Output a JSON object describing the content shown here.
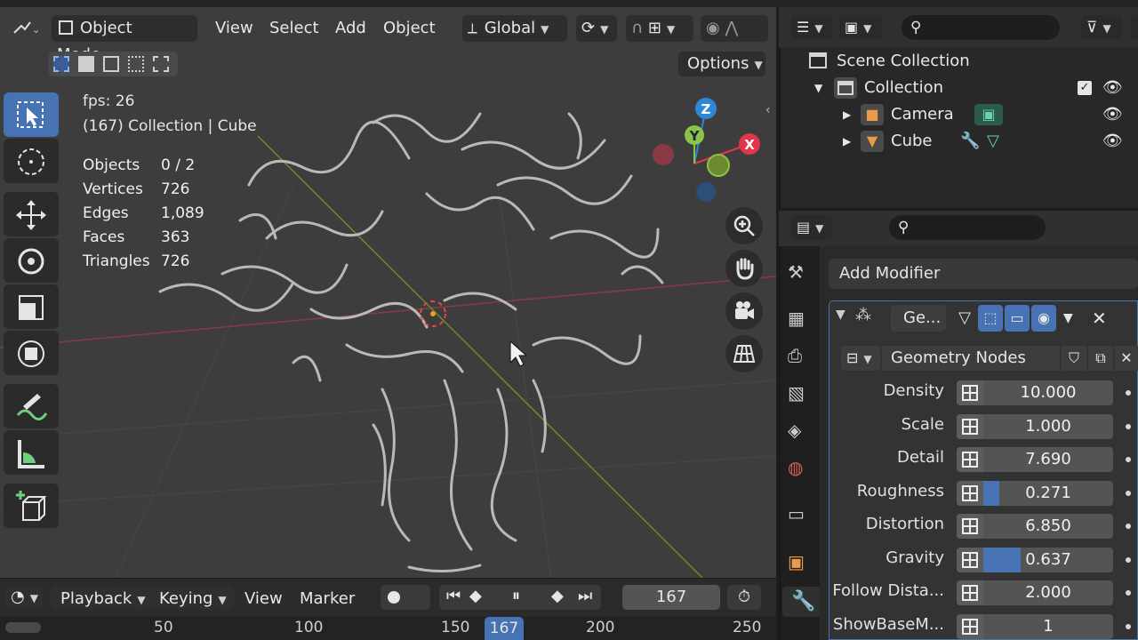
{
  "viewport_header": {
    "mode": "Object Mode",
    "menus": [
      "View",
      "Select",
      "Add",
      "Object"
    ],
    "transform_orientation": "Global",
    "options": "Options"
  },
  "overlay": {
    "fps": "fps: 26",
    "context": "(167) Collection | Cube",
    "stats": [
      {
        "label": "Objects",
        "value": "0 / 2"
      },
      {
        "label": "Vertices",
        "value": "726"
      },
      {
        "label": "Edges",
        "value": "1,089"
      },
      {
        "label": "Faces",
        "value": "363"
      },
      {
        "label": "Triangles",
        "value": "726"
      }
    ]
  },
  "gizmo": {
    "x": "X",
    "y": "Y",
    "z": "Z"
  },
  "timeline": {
    "menus": [
      "Playback",
      "Keying",
      "View",
      "Marker"
    ],
    "current_frame": "167",
    "ruler": [
      "50",
      "100",
      "150",
      "167",
      "200",
      "250"
    ]
  },
  "outliner": {
    "root": "Scene Collection",
    "collection": "Collection",
    "items": [
      {
        "label": "Camera"
      },
      {
        "label": "Cube"
      }
    ]
  },
  "properties": {
    "add_modifier": "Add Modifier",
    "modifier_name": "Ge...",
    "node_group": "Geometry Nodes",
    "inputs": [
      {
        "label": "Density",
        "value": "10.000",
        "fill": 0
      },
      {
        "label": "Scale",
        "value": "1.000",
        "fill": 0
      },
      {
        "label": "Detail",
        "value": "7.690",
        "fill": 0
      },
      {
        "label": "Roughness",
        "value": "0.271",
        "fill": 0.271
      },
      {
        "label": "Distortion",
        "value": "6.850",
        "fill": 0
      },
      {
        "label": "Gravity",
        "value": "0.637",
        "fill": 0.637
      },
      {
        "label": "Follow Dista...",
        "value": "2.000",
        "fill": 0
      },
      {
        "label": "ShowBaseM...",
        "value": "1",
        "fill": 0
      }
    ]
  },
  "colors": {
    "accent": "#4772b3",
    "x_axis": "#e2344b",
    "y_axis": "#8bc34a",
    "z_axis": "#2f86d6"
  }
}
